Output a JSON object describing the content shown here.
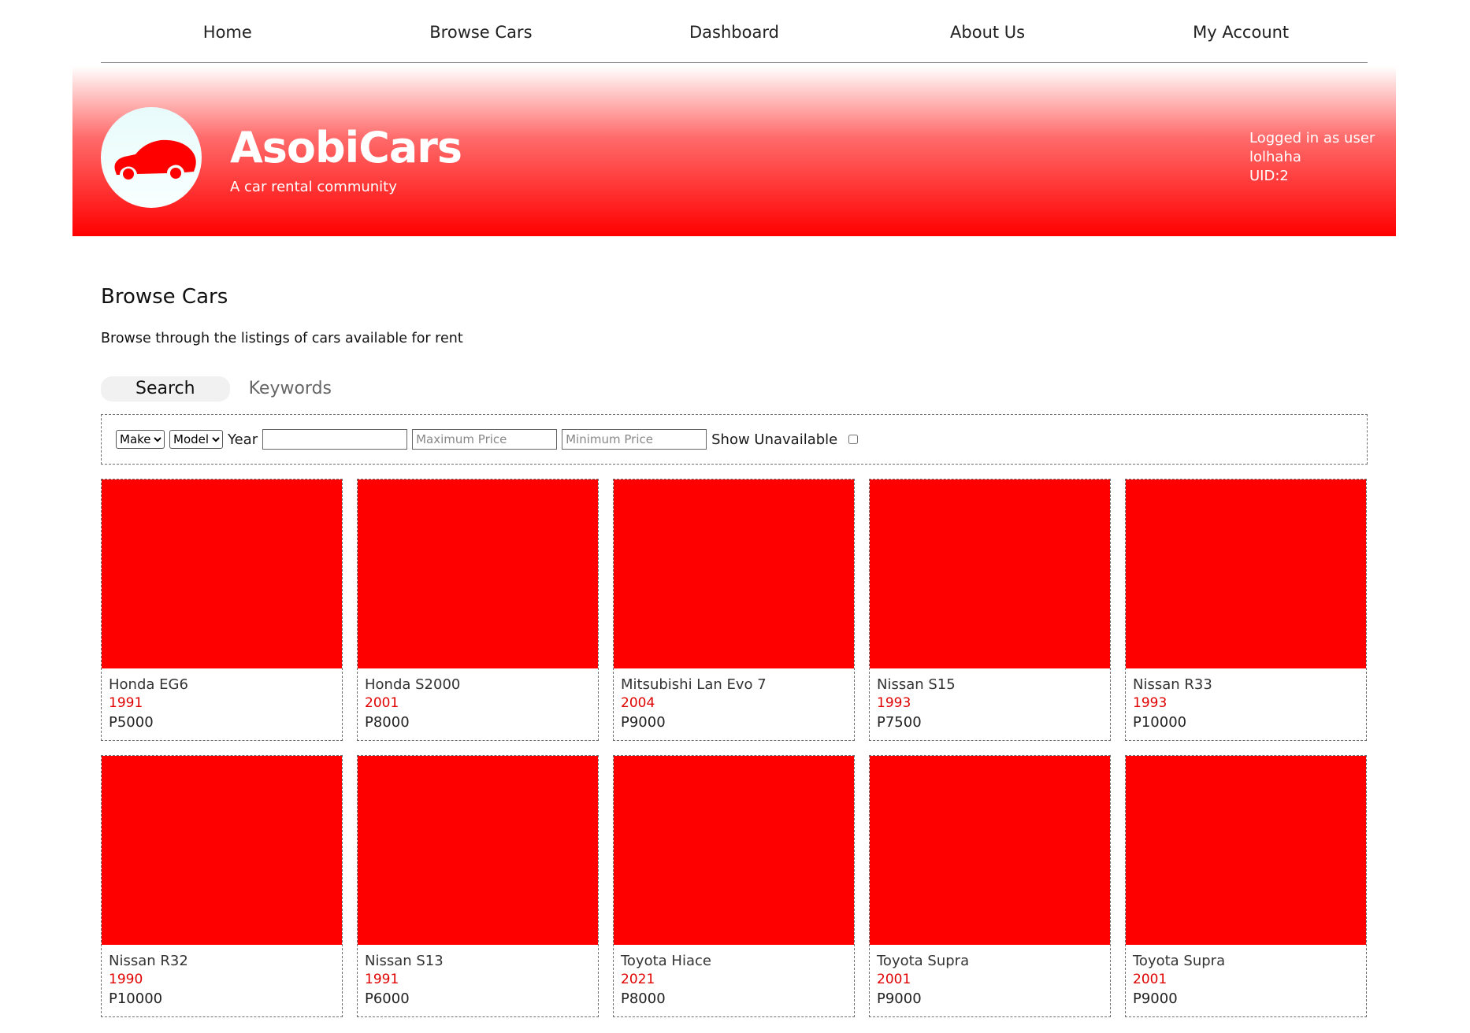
{
  "nav": {
    "items": [
      {
        "label": "Home"
      },
      {
        "label": "Browse Cars"
      },
      {
        "label": "Dashboard"
      },
      {
        "label": "About Us"
      },
      {
        "label": "My Account"
      }
    ]
  },
  "banner": {
    "brand": "AsobiCars",
    "tagline": "A car rental community",
    "user_line1": "Logged in as user",
    "username": "lolhaha",
    "uid": "UID:2",
    "logo_icon": "car-silhouette-icon"
  },
  "main": {
    "title": "Browse Cars",
    "description": "Browse through the listings of cars available for rent",
    "tabs": [
      {
        "label": "Search"
      },
      {
        "label": "Keywords"
      }
    ]
  },
  "filters": {
    "make_label": "Make",
    "model_label": "Model",
    "year_label": "Year",
    "year_value": "",
    "max_price_placeholder": "Maximum Price",
    "min_price_placeholder": "Minimum Price",
    "show_unavailable_label": "Show Unavailable",
    "show_unavailable_checked": false
  },
  "cars": [
    {
      "name": "Honda EG6",
      "year": "1991",
      "price": "P5000"
    },
    {
      "name": "Honda S2000",
      "year": "2001",
      "price": "P8000"
    },
    {
      "name": "Mitsubishi Lan Evo 7",
      "year": "2004",
      "price": "P9000"
    },
    {
      "name": "Nissan S15",
      "year": "1993",
      "price": "P7500"
    },
    {
      "name": "Nissan R33",
      "year": "1993",
      "price": "P10000"
    },
    {
      "name": "Nissan R32",
      "year": "1990",
      "price": "P10000"
    },
    {
      "name": "Nissan S13",
      "year": "1991",
      "price": "P6000"
    },
    {
      "name": "Toyota Hiace",
      "year": "2021",
      "price": "P8000"
    },
    {
      "name": "Toyota Supra",
      "year": "2001",
      "price": "P9000"
    },
    {
      "name": "Toyota Supra",
      "year": "2001",
      "price": "P9000"
    }
  ],
  "colors": {
    "accent": "#ff0000",
    "year_text": "#e00000"
  }
}
